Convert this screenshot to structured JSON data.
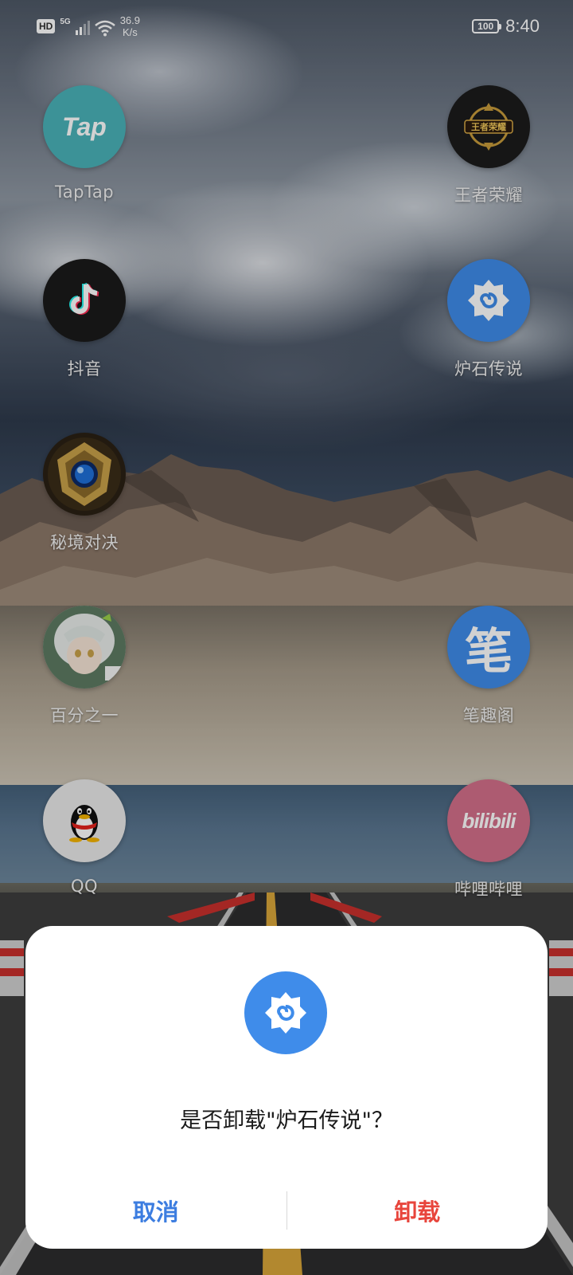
{
  "status_bar": {
    "hd": "HD",
    "network": "5G",
    "net_speed_value": "36.9",
    "net_speed_unit": "K/s",
    "battery": "100",
    "time": "8:40"
  },
  "apps": [
    {
      "label": "TapTap",
      "icon": "taptap-icon",
      "color": "#4ab3b9"
    },
    {
      "label": "王者荣耀",
      "icon": "honor-of-kings-icon",
      "color": "#1c1c1c"
    },
    {
      "label": "抖音",
      "icon": "douyin-icon",
      "color": "#1a1a1a"
    },
    {
      "label": "炉石传说",
      "icon": "hearthstone-icon",
      "color": "#3f8cea"
    },
    {
      "label": "秘境对决",
      "icon": "mijing-duijue-icon",
      "color": "#2a2014"
    },
    {
      "label": "百分之一",
      "icon": "baifenzhiyi-icon",
      "color": "#c9d6c8"
    },
    {
      "label": "笔趣阁",
      "icon": "biquge-icon",
      "color": "#3f8cea"
    },
    {
      "label": "QQ",
      "icon": "qq-icon",
      "color": "#e9e9e9"
    },
    {
      "label": "哔哩哔哩",
      "icon": "bilibili-icon",
      "color": "#d4708a"
    }
  ],
  "app_icon_text": {
    "taptap": "Tap",
    "honor_of_kings": "王者荣耀",
    "biquge": "笔",
    "bilibili": "bilibili"
  },
  "dialog": {
    "icon": "hearthstone-icon",
    "message": "是否卸载\"炉石传说\"？",
    "cancel_label": "取消",
    "uninstall_label": "卸载",
    "cancel_color": "#3c7de0",
    "uninstall_color": "#e8453c"
  }
}
